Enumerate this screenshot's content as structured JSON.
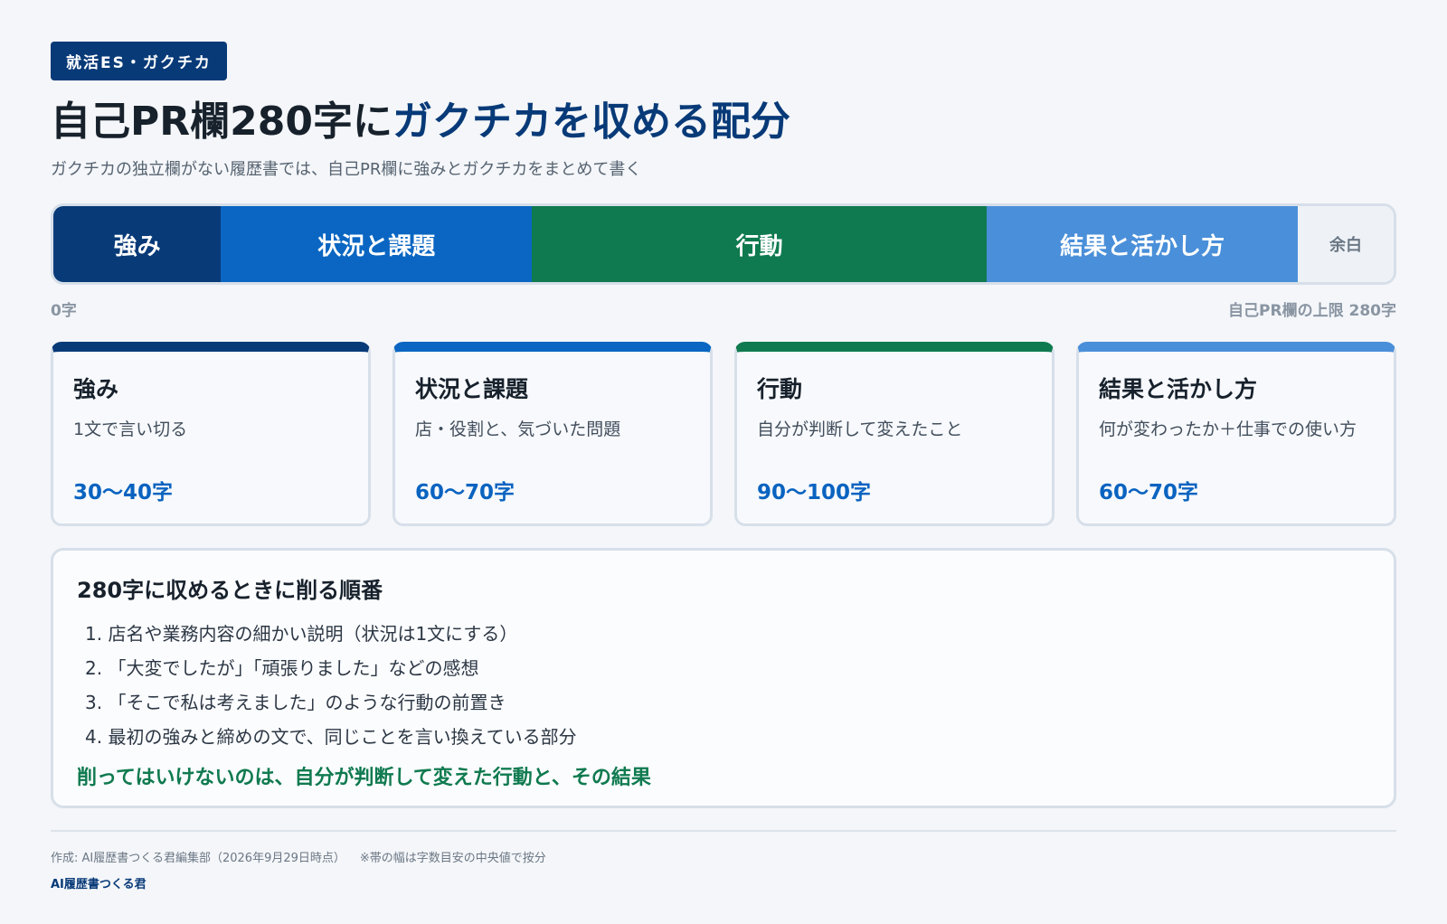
{
  "tag": "就活ES・ガクチカ",
  "title": {
    "plain": "自己PR欄280字に",
    "accent": "ガクチカを収める配分"
  },
  "subtitle": "ガクチカの独立欄がない履歴書では、自己PR欄に強みとガクチカをまとめて書く",
  "colors": {
    "navy": "#083a78",
    "blue": "#0a66c2",
    "green": "#0f7a4f",
    "light_blue": "#4a8fd9",
    "rest": "#eef2f6"
  },
  "bar": {
    "total_chars": 280,
    "segments": [
      {
        "label": "強み",
        "chars": 35,
        "color": "#083a78"
      },
      {
        "label": "状況と課題",
        "chars": 65,
        "color": "#0a66c2"
      },
      {
        "label": "行動",
        "chars": 95,
        "color": "#0f7a4f"
      },
      {
        "label": "結果と活かし方",
        "chars": 65,
        "color": "#4a8fd9"
      }
    ],
    "rest_label": "余白",
    "rest_chars": 20,
    "scale_start": "0字",
    "scale_end": "自己PR欄の上限 280字"
  },
  "cards": [
    {
      "title": "強み",
      "desc": "1文で言い切る",
      "count": "30〜40字",
      "color": "#083a78"
    },
    {
      "title": "状況と課題",
      "desc": "店・役割と、気づいた問題",
      "count": "60〜70字",
      "color": "#0a66c2"
    },
    {
      "title": "行動",
      "desc": "自分が判断して変えたこと",
      "count": "90〜100字",
      "color": "#0f7a4f"
    },
    {
      "title": "結果と活かし方",
      "desc": "何が変わったか＋仕事での使い方",
      "count": "60〜70字",
      "color": "#4a8fd9"
    }
  ],
  "order": {
    "heading": "280字に収めるときに削る順番",
    "items": [
      "1. 店名や業務内容の細かい説明（状況は1文にする）",
      "2. 「大変でしたが」「頑張りました」などの感想",
      "3. 「そこで私は考えました」のような行動の前置き",
      "4. 最初の強みと締めの文で、同じことを言い換えている部分"
    ],
    "keep": "削ってはいけないのは、自分が判断して変えた行動と、その結果"
  },
  "footer": {
    "credit": "作成: AI履歴書つくる君編集部（2026年9月29日時点）",
    "note": "※帯の幅は字数目安の中央値で按分",
    "brand": "AI履歴書つくる君"
  }
}
